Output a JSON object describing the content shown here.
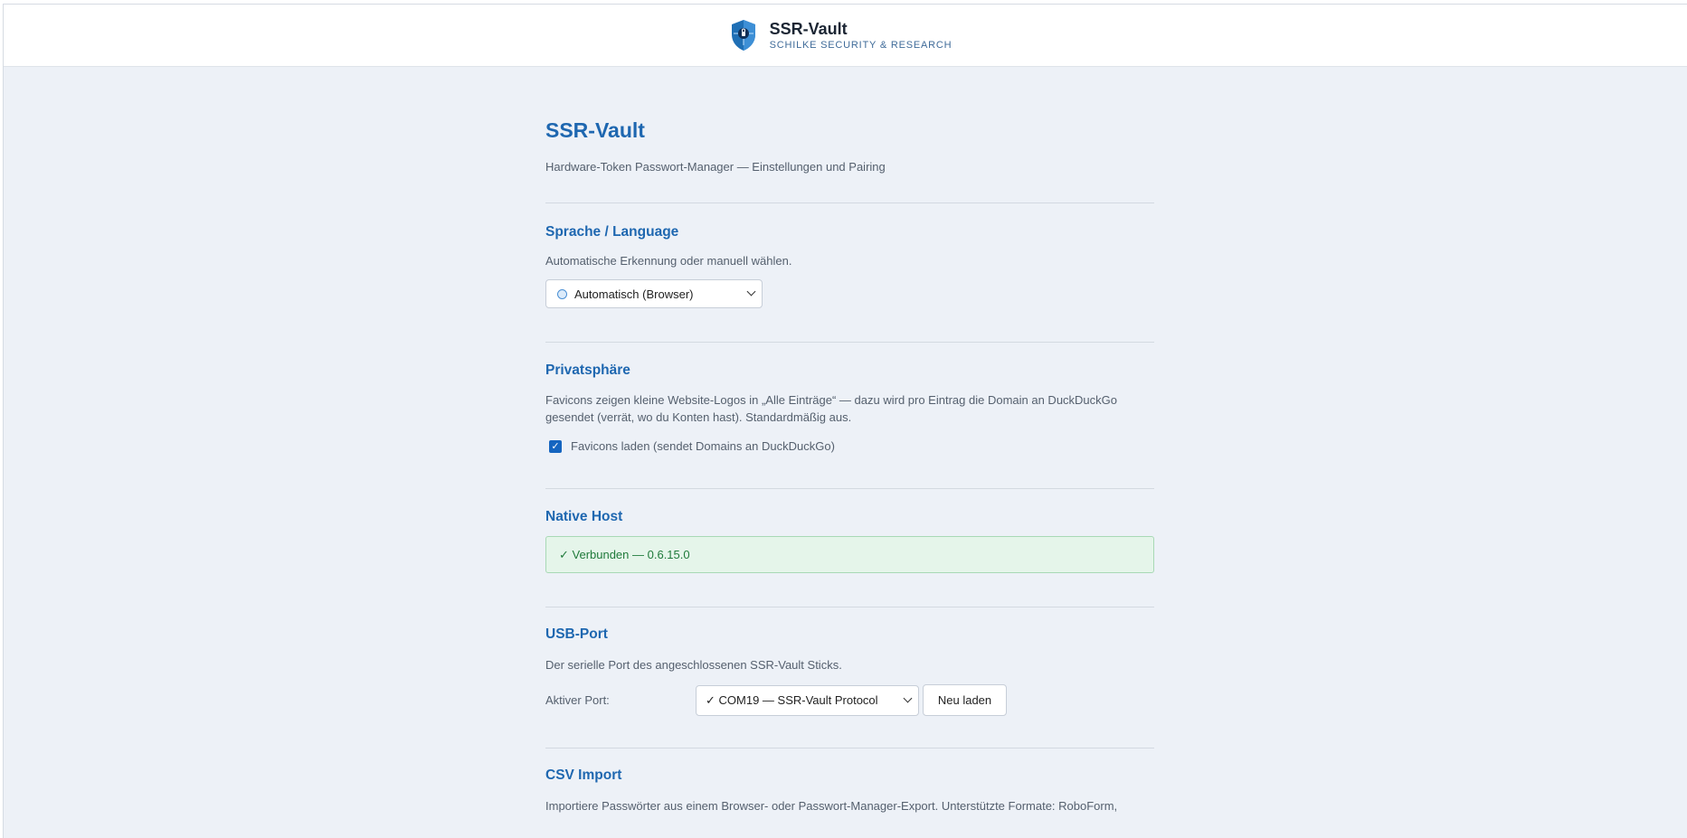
{
  "header": {
    "brand_title": "SSR-Vault",
    "brand_subtitle": "SCHILKE SECURITY & RESEARCH",
    "logo_icon": "shield-lock-icon"
  },
  "page": {
    "title": "SSR-Vault",
    "subtitle": "Hardware-Token Passwort-Manager — Einstellungen und Pairing"
  },
  "language": {
    "heading": "Sprache / Language",
    "description": "Automatische Erkennung oder manuell wählen.",
    "selected": "Automatisch (Browser)",
    "icon": "globe-icon"
  },
  "privacy": {
    "heading": "Privatsphäre",
    "description_line1": "Favicons zeigen kleine Website-Logos in „Alle Einträge“ — dazu wird pro Eintrag die Domain an DuckDuckGo",
    "description_line2": "gesendet (verrät, wo du Konten hast). Standardmäßig aus.",
    "checkbox_label": "Favicons laden (sendet Domains an DuckDuckGo)",
    "checkbox_checked": true
  },
  "native_host": {
    "heading": "Native Host",
    "status": "✓ Verbunden — 0.6.15.0",
    "status_color": "#207a3b"
  },
  "usb_port": {
    "heading": "USB-Port",
    "description": "Der serielle Port des angeschlossenen SSR-Vault Sticks.",
    "label": "Aktiver Port:",
    "selected": "✓ COM19 — SSR-Vault Protocol",
    "reload_label": "Neu laden"
  },
  "csv_import": {
    "heading": "CSV Import",
    "description": "Importiere Passwörter aus einem Browser- oder Passwort-Manager-Export. Unterstützte Formate: RoboForm,"
  },
  "colors": {
    "accent": "#1e67b0",
    "background": "#edf1f7",
    "success_bg": "#e5f5ea"
  }
}
